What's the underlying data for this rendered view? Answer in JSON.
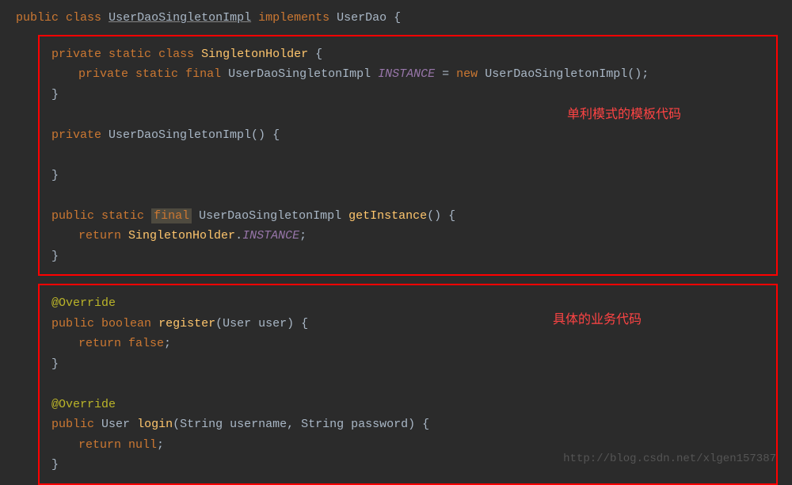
{
  "declaration": {
    "public": "public",
    "class": "class",
    "className": "UserDaoSingletonImpl",
    "implements": "implements",
    "interface": "UserDao",
    "openBrace": " {"
  },
  "box1": {
    "line1": {
      "private": "private",
      "static": "static",
      "class": "class",
      "name": "SingletonHolder",
      "brace": " {"
    },
    "line2": {
      "private": "private",
      "static": "static",
      "final": "final",
      "type": "UserDaoSingletonImpl",
      "var": "INSTANCE",
      "eq": " = ",
      "new": "new",
      "ctor": "UserDaoSingletonImpl();"
    },
    "line3": "}",
    "line4": {
      "private": "private",
      "ctor": "UserDaoSingletonImpl() {"
    },
    "line5": "}",
    "line6": {
      "public": "public",
      "static": "static",
      "final": "final",
      "type": "UserDaoSingletonImpl",
      "method": "getInstance",
      "params": "() {"
    },
    "line7": {
      "return": "return",
      "holder": "SingletonHolder",
      "dot": ".",
      "instance": "INSTANCE",
      "semi": ";"
    },
    "line8": "}",
    "annotation": "单利模式的模板代码"
  },
  "box2": {
    "line1": "@Override",
    "line2": {
      "public": "public",
      "boolean": "boolean",
      "method": "register",
      "paren1": "(",
      "type": "User",
      "param": " user) {"
    },
    "line3": {
      "return": "return",
      "val": "false",
      "semi": ";"
    },
    "line4": "}",
    "line5": "@Override",
    "line6": {
      "public": "public",
      "type": "User",
      "method": "login",
      "paren1": "(",
      "ptype1": "String",
      "pname1": " username, ",
      "ptype2": "String",
      "pname2": " password) {"
    },
    "line7": {
      "return": "return",
      "val": "null",
      "semi": ";"
    },
    "line8": "}",
    "annotation": "具体的业务代码"
  },
  "watermark": "http://blog.csdn.net/xlgen157387"
}
